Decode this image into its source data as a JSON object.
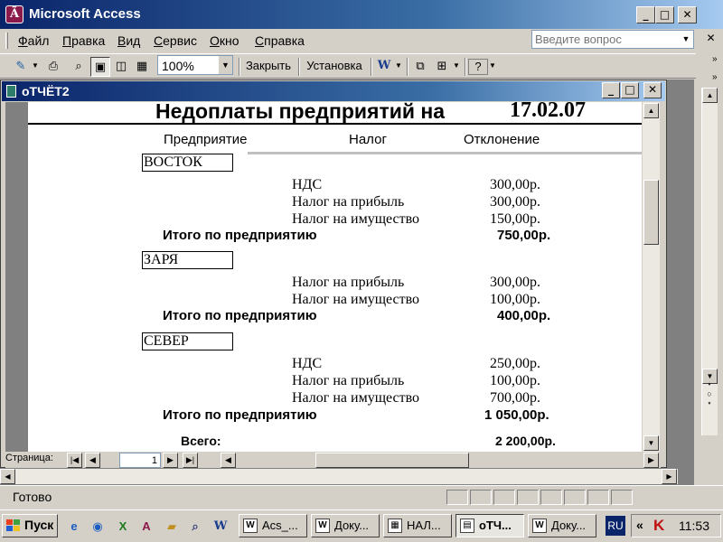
{
  "app": {
    "title": "Microsoft Access",
    "icon": "access-icon"
  },
  "menu": {
    "items": [
      {
        "label": "Файл",
        "accel": "Ф",
        "rest": "айл"
      },
      {
        "label": "Правка",
        "accel": "П",
        "rest": "равка"
      },
      {
        "label": "Вид",
        "accel": "В",
        "rest": "ид"
      },
      {
        "label": "Сервис",
        "accel": "С",
        "rest": "ервис"
      },
      {
        "label": "Окно",
        "accel": "О",
        "rest": "кно"
      },
      {
        "label": "Справка",
        "accel": "С",
        "rest": "правка"
      }
    ],
    "question_placeholder": "Введите вопрос"
  },
  "toolbar": {
    "zoom": "100%",
    "close_label": "Закрыть",
    "setup_label": "Установка"
  },
  "report_window": {
    "title": "оТЧЁТ2"
  },
  "report": {
    "title": "Недоплаты предприятий на",
    "date": "17.02.07",
    "columns": [
      "Предприятие",
      "Налог",
      "Отклонение"
    ],
    "groups": [
      {
        "company": "ВОСТОК",
        "rows": [
          {
            "tax": "НДС",
            "amount": "300,00р."
          },
          {
            "tax": "Налог на прибыль",
            "amount": "300,00р."
          },
          {
            "tax": "Налог на имущество",
            "amount": "150,00р."
          }
        ],
        "subtotal_label": "Итого по предприятию",
        "subtotal": "750,00р."
      },
      {
        "company": "ЗАРЯ",
        "rows": [
          {
            "tax": "Налог на прибыль",
            "amount": "300,00р."
          },
          {
            "tax": "Налог на имущество",
            "amount": "100,00р."
          }
        ],
        "subtotal_label": "Итого по предприятию",
        "subtotal": "400,00р."
      },
      {
        "company": "СЕВЕР",
        "rows": [
          {
            "tax": "НДС",
            "amount": "250,00р."
          },
          {
            "tax": "Налог на прибыль",
            "amount": "100,00р."
          },
          {
            "tax": "Налог на имущество",
            "amount": "700,00р."
          }
        ],
        "subtotal_label": "Итого по предприятию",
        "subtotal": "1 050,00р."
      }
    ],
    "total_label": "Всего:",
    "total": "2 200,00р."
  },
  "navigation": {
    "pages_label": "Страница:",
    "page_value": "1"
  },
  "status": {
    "text": "Готово"
  },
  "taskbar": {
    "start_label": "Пуск",
    "tasks": [
      {
        "label": "Acs_...",
        "icon": "W"
      },
      {
        "label": "Доку...",
        "icon": "W"
      },
      {
        "label": "НАЛ...",
        "icon": "▦"
      },
      {
        "label": "оТЧ...",
        "icon": "▤",
        "active": true
      },
      {
        "label": "Доку...",
        "icon": "W"
      }
    ],
    "language": "RU",
    "tray_chevron": "«",
    "clock": "11:53"
  },
  "colors": {
    "title_gradient_start": "#0a246a",
    "title_gradient_end": "#a6caf0",
    "face": "#d4d0c8"
  }
}
